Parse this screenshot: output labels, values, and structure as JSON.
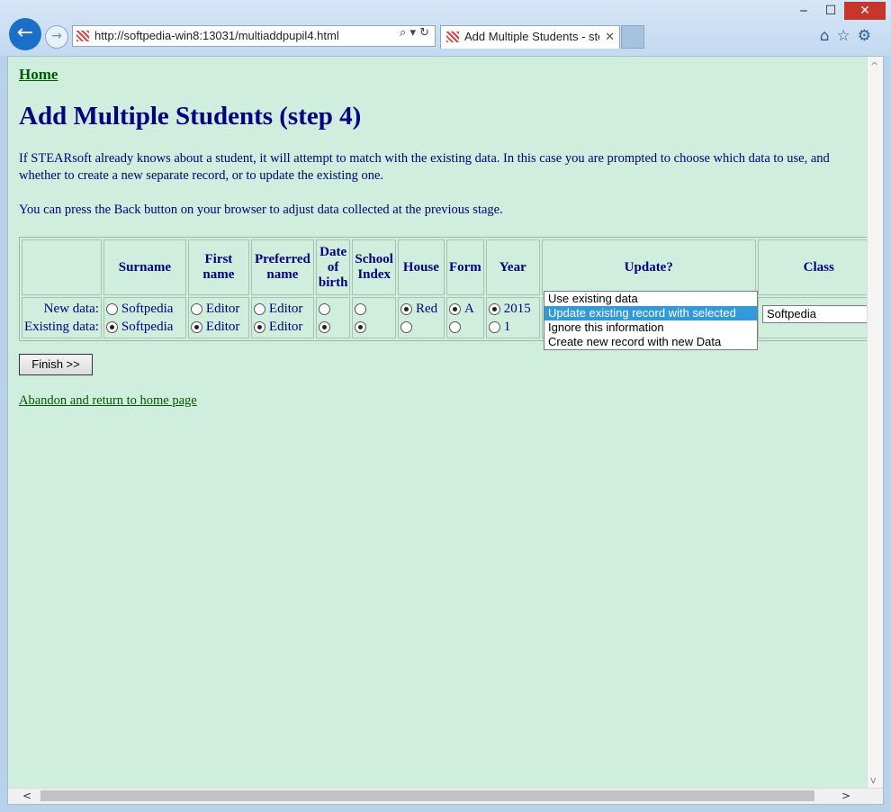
{
  "browser": {
    "address": "http://softpedia-win8:13031/multiaddpupil4.html",
    "tab_title": "Add Multiple Students - ste...",
    "tab_close": "✕",
    "win_min": "‒",
    "win_max": "☐",
    "win_close": "✕"
  },
  "page": {
    "home_link": "Home",
    "title": "Add Multiple Students (step 4)",
    "intro": "If STEARsoft already knows about a student, it will attempt to match with the existing data. In this case you are prompted to choose which data to use, and whether to create a new separate record, or to update the existing one.",
    "back_hint": "You can press the Back button on your browser to adjust data collected at the previous stage.",
    "finish_button": "Finish >>",
    "abandon_link": "Abandon and return to home page"
  },
  "table": {
    "headers": [
      "Surname",
      "First name",
      "Preferred name",
      "Date of birth",
      "School Index",
      "House",
      "Form",
      "Year",
      "Update?",
      "Class"
    ],
    "row_labels": [
      "New data:",
      "Existing data:"
    ],
    "surname": [
      "Softpedia",
      "Softpedia"
    ],
    "first_name": [
      "Editor",
      "Editor"
    ],
    "preferred_name": [
      "Editor",
      "Editor"
    ],
    "date_of_birth": [
      "",
      ""
    ],
    "school_index": [
      "",
      ""
    ],
    "house": [
      "Red",
      ""
    ],
    "form": [
      "A",
      ""
    ],
    "year": [
      "2015",
      "1"
    ]
  },
  "update_options": [
    "Use existing data",
    "Update existing record with selected",
    "Ignore this information",
    "Create new record with new Data"
  ],
  "update_selected": "Update existing record with selected",
  "class_value": "Softpedia"
}
